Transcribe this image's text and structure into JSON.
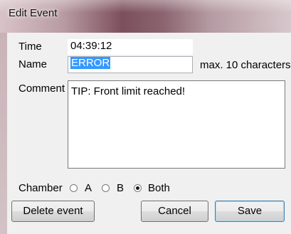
{
  "window": {
    "title": "Edit Event"
  },
  "form": {
    "time_label": "Time",
    "time_value": "04:39:12",
    "name_label": "Name",
    "name_value": "ERROR",
    "name_hint": "max. 10 characters",
    "comment_label": "Comment",
    "comment_value": "TIP: Front limit reached!",
    "chamber_label": "Chamber",
    "chamber_options": [
      {
        "label": "A",
        "selected": false
      },
      {
        "label": "B",
        "selected": false
      },
      {
        "label": "Both",
        "selected": true
      }
    ]
  },
  "buttons": {
    "delete_label": "Delete event",
    "cancel_label": "Cancel",
    "save_label": "Save"
  }
}
